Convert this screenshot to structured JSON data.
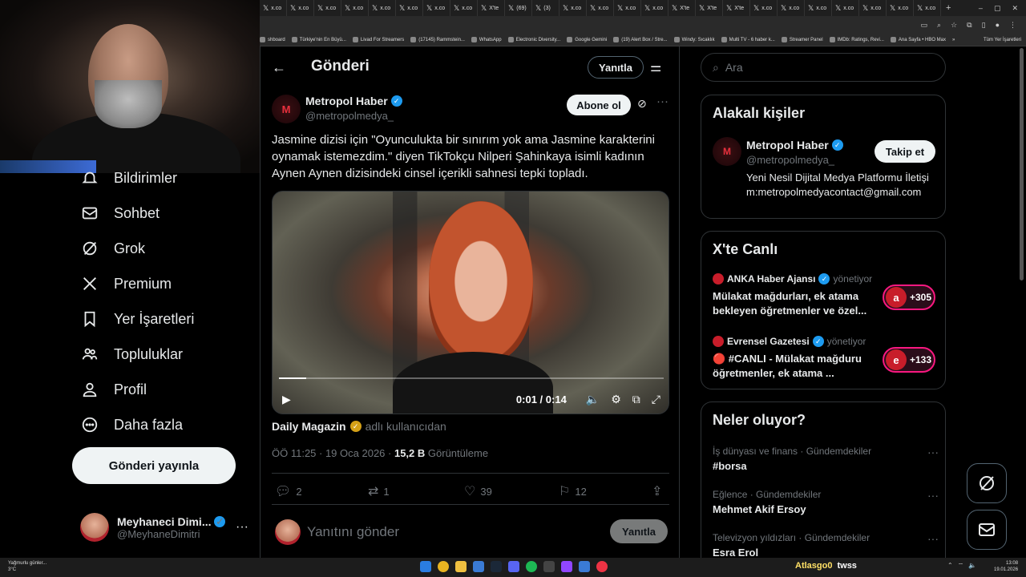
{
  "browser": {
    "tabs": [
      "x.co",
      "x.co",
      "x.co",
      "x.co",
      "x.co",
      "x.co",
      "x.co",
      "x.co",
      "X'te",
      "(69)",
      "(3)",
      "x.co",
      "x.co",
      "x.co",
      "x.co",
      "X'te",
      "X'te",
      "X'te",
      "x.co",
      "x.co",
      "x.co",
      "x.co",
      "x.co",
      "x.co",
      "x.co"
    ],
    "new_tab": "+",
    "bookmarks": [
      "shboard",
      "Türkiye'nin En Büyü...",
      "Livad For Streamers",
      "(17145) Rammstein...",
      "WhatsApp",
      "Electronic Diversity...",
      "Google Gemini",
      "(19) Alert Box / Stre...",
      "Windy: Sıcaklık",
      "Multi TV - 6 haber k...",
      "Streamer Panel",
      "IMDb: Ratings, Revi...",
      "Ana Sayfa • HBO Max"
    ],
    "bookmarks_more": "»",
    "bookmarks_folder": "Tüm Yer İşaretleri"
  },
  "nav": {
    "items": [
      {
        "label": "Bildirimler",
        "icon": "bell-icon"
      },
      {
        "label": "Sohbet",
        "icon": "mail-icon"
      },
      {
        "label": "Grok",
        "icon": "grok-icon"
      },
      {
        "label": "Premium",
        "icon": "x-logo-icon"
      },
      {
        "label": "Yer İşaretleri",
        "icon": "bookmark-icon"
      },
      {
        "label": "Topluluklar",
        "icon": "people-icon"
      },
      {
        "label": "Profil",
        "icon": "person-icon"
      },
      {
        "label": "Daha fazla",
        "icon": "more-circle-icon"
      }
    ],
    "post_button": "Gönderi yayınla",
    "account": {
      "name": "Meyhaneci Dimi...",
      "handle": "@MeyhaneDimitri"
    }
  },
  "header": {
    "title": "Gönderi",
    "reply_label": "Yanıtla"
  },
  "post": {
    "author": "Metropol Haber",
    "handle": "@metropolmedya_",
    "avatar_letter": "M",
    "subscribe_label": "Abone ol",
    "text": "Jasmine dizisi için \"Oyunculukta bir sınırım yok ama Jasmine karakterini oynamak istemezdim.\" diyen TikTokçu Nilperi Şahinkaya isimli kadının Aynen Aynen dizisindeki cinsel içerikli sahnesi tepki topladı.",
    "video": {
      "time": "0:01 / 0:14",
      "progress": 0.07
    },
    "source_name": "Daily Magazin",
    "source_suffix": "adlı kullanıcıdan",
    "timestamp": "ÖÖ 11:25 · 19 Oca 2026 ·",
    "views": "15,2 B",
    "views_label": "Görüntüleme",
    "stats": {
      "replies": "2",
      "reposts": "1",
      "likes": "39",
      "bookmarks": "12"
    },
    "reply_placeholder": "Yanıtını gönder",
    "reply_button": "Yanıtla"
  },
  "right": {
    "search_placeholder": "Ara",
    "related": {
      "title": "Alakalı kişiler",
      "name": "Metropol Haber",
      "handle": "@metropolmedya_",
      "follow_label": "Takip et",
      "bio": "Yeni Nesil Dijital Medya Platformu İletişim:metropolmedyacontact@gmail.com"
    },
    "live": {
      "title": "X'te Canlı",
      "items": [
        {
          "host": "ANKA Haber Ajansı",
          "role": "yönetiyor",
          "text": "Mülakat mağdurları, ek atama bekleyen öğretmenler ve özel...",
          "count": "+305"
        },
        {
          "host": "Evrensel Gazetesi",
          "role": "yönetiyor",
          "text": "🔴 #CANLI - Mülakat mağduru öğretmenler, ek atama ...",
          "count": "+133"
        }
      ]
    },
    "trends": {
      "title": "Neler oluyor?",
      "items": [
        {
          "category": "İş dünyası ve finans · Gündemdekiler",
          "name": "#borsa"
        },
        {
          "category": "Eğlence · Gündemdekiler",
          "name": "Mehmet Akif Ersoy"
        },
        {
          "category": "Televizyon yıldızları · Gündemdekiler",
          "name": "Esra Erol"
        }
      ]
    }
  },
  "taskbar": {
    "weather_line1": "Yağmurlu günler...",
    "weather_line2": "3°C",
    "user": "Atlasgo0",
    "user_suffix": "twss",
    "time": "13:08",
    "date": "19.01.2026"
  },
  "colors": {
    "accent": "#1d9bf0",
    "live": "#f91880",
    "brand_red": "#e8303d"
  }
}
